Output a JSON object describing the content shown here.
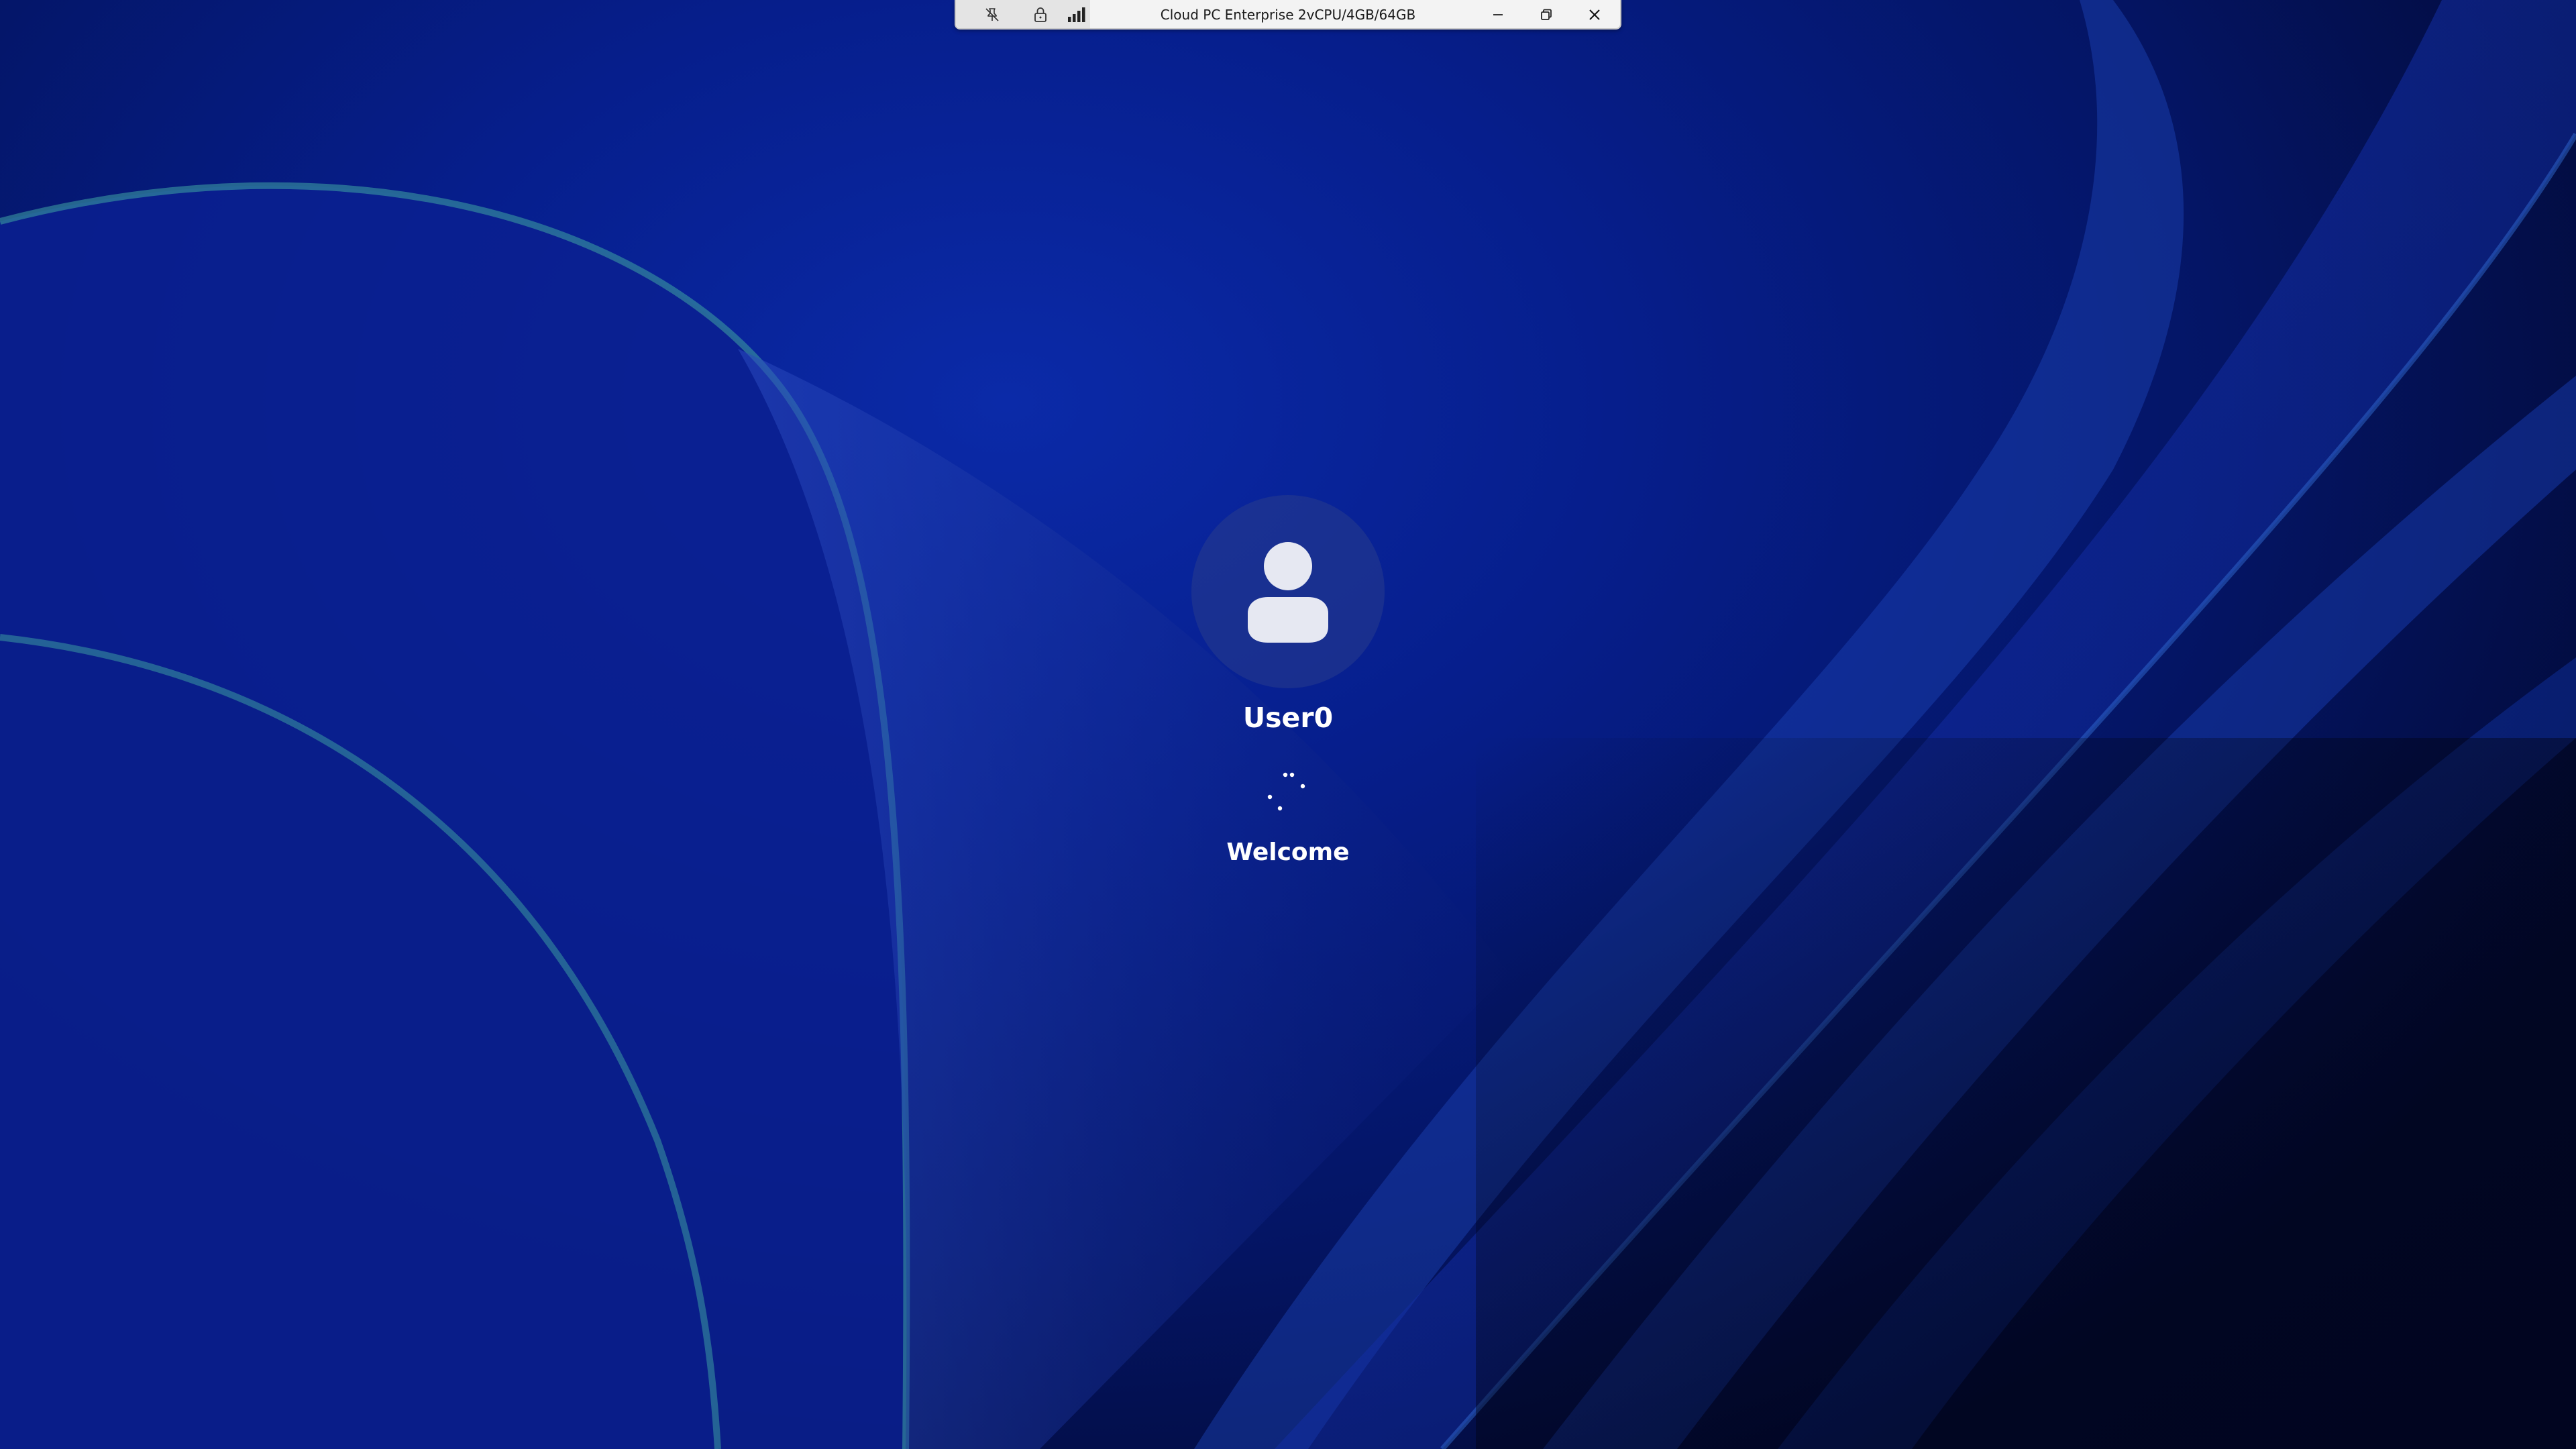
{
  "connection_bar": {
    "title": "Cloud PC Enterprise 2vCPU/4GB/64GB",
    "icons": [
      "pin-off-icon",
      "lock-icon",
      "signal-strength-icon"
    ],
    "controls": [
      "minimize-icon",
      "restore-icon",
      "close-icon"
    ]
  },
  "login": {
    "username": "User0",
    "status": "Welcome",
    "avatar_icon": "user-avatar-icon",
    "spinner_icon": "loading-spinner-icon"
  },
  "colors": {
    "background": "#061e8c",
    "text": "#ffffff",
    "bar": "#f3f3f3"
  }
}
